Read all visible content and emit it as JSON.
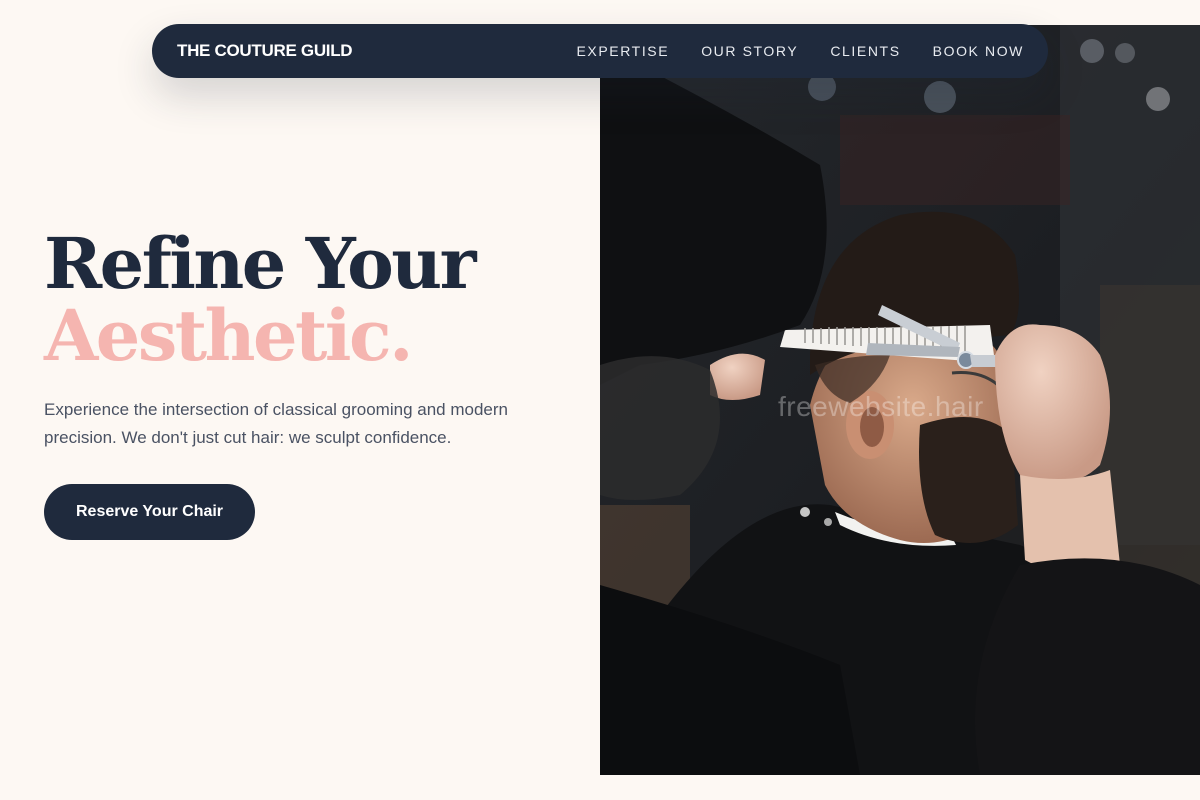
{
  "nav": {
    "brand": "THE COUTURE GUILD",
    "links": [
      {
        "label": "EXPERTISE"
      },
      {
        "label": "OUR STORY"
      },
      {
        "label": "CLIENTS"
      },
      {
        "label": "BOOK NOW"
      }
    ]
  },
  "hero": {
    "headline_line1": "Refine Your",
    "headline_line2": "Aesthetic.",
    "lede": "Experience the intersection of classical grooming and modern precision. We don't just cut hair: we sculpt confidence.",
    "cta_label": "Reserve Your Chair",
    "image_watermark": "freewebsite.hair"
  },
  "colors": {
    "background": "#fdf8f3",
    "navy": "#1f2a3d",
    "accent_pink": "#f5b5b0",
    "body_text": "#4a5263"
  }
}
